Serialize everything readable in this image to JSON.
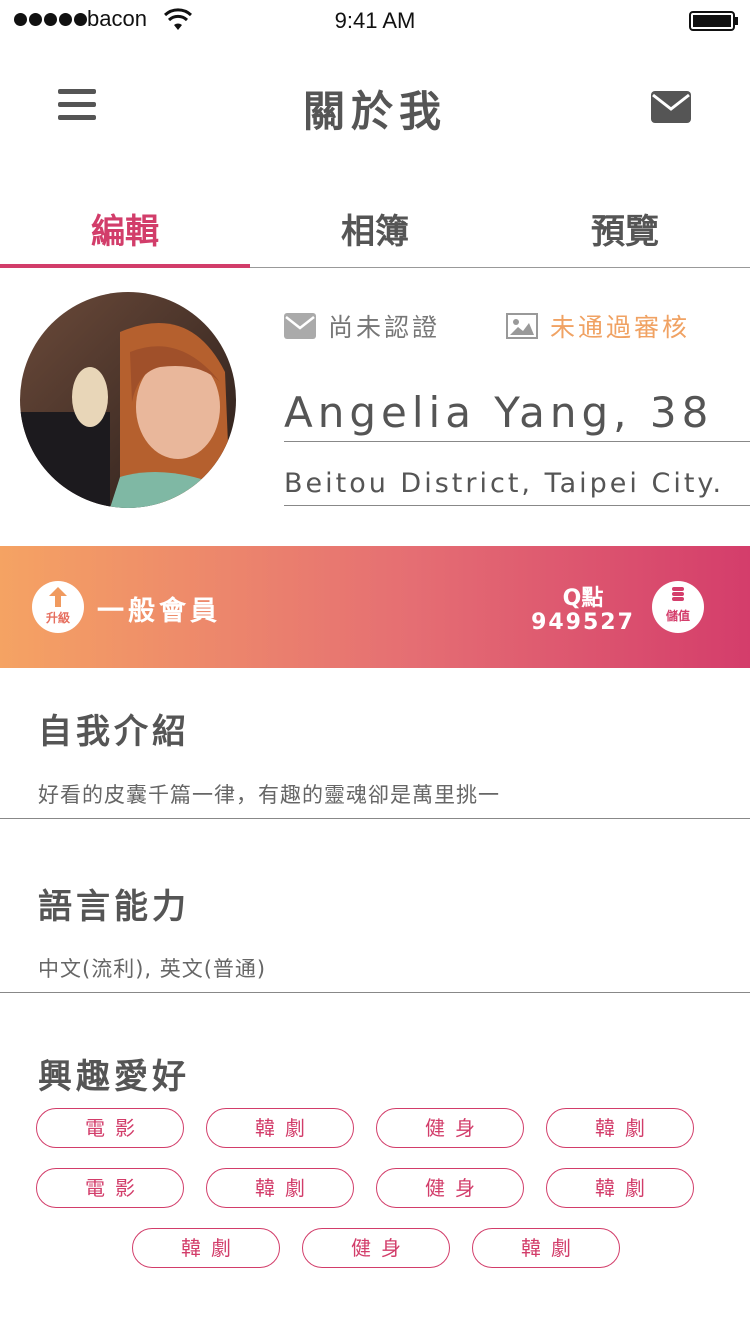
{
  "status_bar": {
    "carrier": "bacon",
    "time": "9:41 AM"
  },
  "nav": {
    "title": "關於我"
  },
  "tabs": [
    {
      "label": "編輯",
      "active": true
    },
    {
      "label": "相簿",
      "active": false
    },
    {
      "label": "預覽",
      "active": false
    }
  ],
  "profile": {
    "verify_status": "尚未認證",
    "review_status": "未通過審核",
    "name": "Angelia Yang, 38",
    "location": "Beitou District, Taipei City."
  },
  "membership": {
    "upgrade_label": "升級",
    "level": "一般會員",
    "points_label": "Q點",
    "points_value": "949527",
    "topup_label": "儲值"
  },
  "sections": {
    "intro": {
      "title": "自我介紹",
      "text": "好看的皮囊千篇一律，有趣的靈魂卻是萬里挑一"
    },
    "language": {
      "title": "語言能力",
      "text": "中文(流利), 英文(普通)"
    },
    "hobbies": {
      "title": "興趣愛好",
      "tags": [
        "電影",
        "韓劇",
        "健身",
        "韓劇",
        "電影",
        "韓劇",
        "健身",
        "韓劇",
        "韓劇",
        "健身",
        "韓劇"
      ]
    }
  },
  "colors": {
    "accent": "#d23d6a",
    "warning": "#f0a263",
    "gradient_start": "#f5a363",
    "gradient_end": "#d43d6b"
  }
}
